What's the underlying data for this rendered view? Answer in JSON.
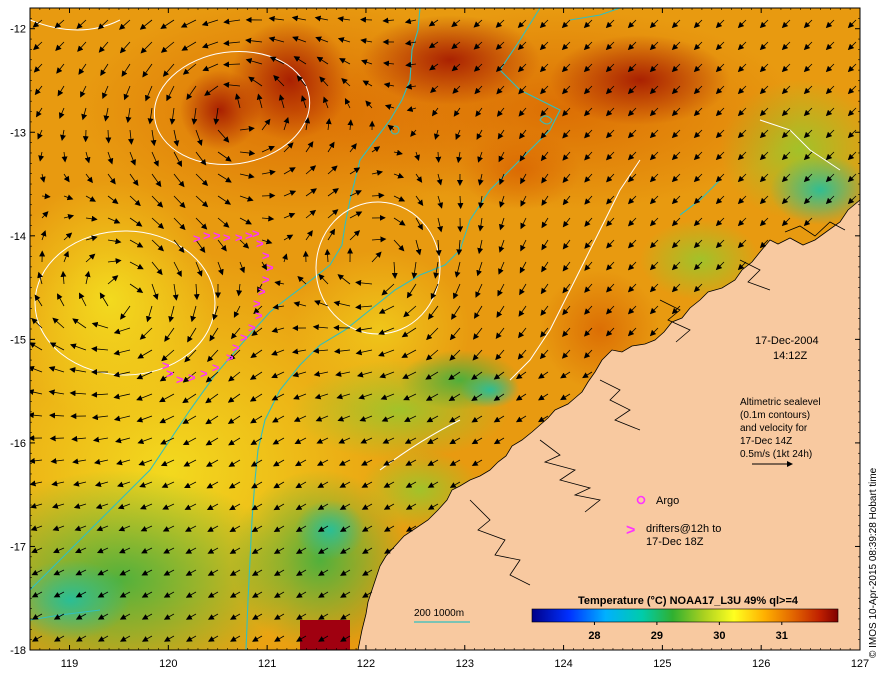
{
  "map": {
    "lat_ticks": [
      "-12",
      "-13",
      "-14",
      "-15",
      "-16",
      "-17",
      "-18"
    ],
    "lon_ticks": [
      "119",
      "120",
      "121",
      "122",
      "123",
      "124",
      "125",
      "126",
      "127"
    ],
    "lon_range": [
      118.6,
      127
    ],
    "lat_range": [
      -18,
      -11.8
    ]
  },
  "annotations": {
    "date": "17-Dec-2004",
    "time": "14:12Z",
    "altimetry_line1": "Altimetric sealevel",
    "altimetry_line2": "(0.1m contours)",
    "altimetry_line3": "and velocity for",
    "altimetry_line4": "17-Dec 14Z",
    "altimetry_line5": "0.5m/s (1kt 24h)"
  },
  "legend": {
    "argo_label": "Argo",
    "drifters_line1": "drifters@12h to",
    "drifters_line2": "17-Dec 18Z",
    "drifter_symbol": ">",
    "isobath_label": "200  1000m",
    "colorbar_title": "Temperature (°C) NOAA17_L3U 49% ql>=4",
    "colorbar_ticks": [
      "28",
      "29",
      "30",
      "31"
    ],
    "colorbar_range": [
      27.0,
      31.9
    ]
  },
  "credit": "© IMOS 10-Apr-2015 08:39:28 Hobart time",
  "colors": {
    "land": "#f8c9a0",
    "drifter": "#ff33ff",
    "argo": "#ff33ff",
    "isobath": "#30c0c0",
    "contour": "#ffffff",
    "arrow": "#000000"
  }
}
